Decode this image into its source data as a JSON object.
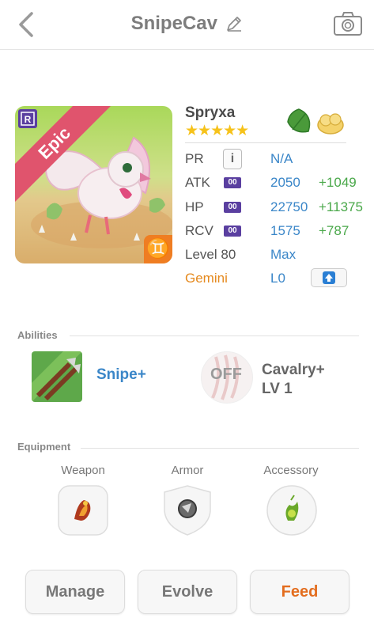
{
  "header": {
    "title": "SnipeCav"
  },
  "monster": {
    "name": "Spryxa",
    "stars": "★★★★★",
    "rarity": "Epic",
    "rarity_color": "#e0546d",
    "zodiac_symbol": "♊"
  },
  "stats": {
    "pr": {
      "label": "PR",
      "value": "N/A"
    },
    "atk": {
      "label": "ATK",
      "badge": "00",
      "value": "2050",
      "bonus": "+1049"
    },
    "hp": {
      "label": "HP",
      "badge": "00",
      "value": "22750",
      "bonus": "+11375"
    },
    "rcv": {
      "label": "RCV",
      "badge": "00",
      "value": "1575",
      "bonus": "+787"
    },
    "level": {
      "label": "Level 80",
      "value": "Max"
    },
    "sign": {
      "label": "Gemini",
      "value": "L0"
    }
  },
  "abilities": {
    "section_label": "Abilities",
    "active": {
      "name": "Snipe+"
    },
    "passive": {
      "status": "OFF",
      "name_line1": "Cavalry+",
      "name_line2": "LV 1"
    }
  },
  "equipment": {
    "section_label": "Equipment",
    "slots": [
      {
        "label": "Weapon"
      },
      {
        "label": "Armor"
      },
      {
        "label": "Accessory"
      }
    ]
  },
  "actions": {
    "manage": "Manage",
    "evolve": "Evolve",
    "feed": "Feed"
  },
  "colors": {
    "value_blue": "#3a86c8",
    "bonus_green": "#4aa84a",
    "gemini_orange": "#e58a1f",
    "feed_orange": "#e36d1e"
  }
}
